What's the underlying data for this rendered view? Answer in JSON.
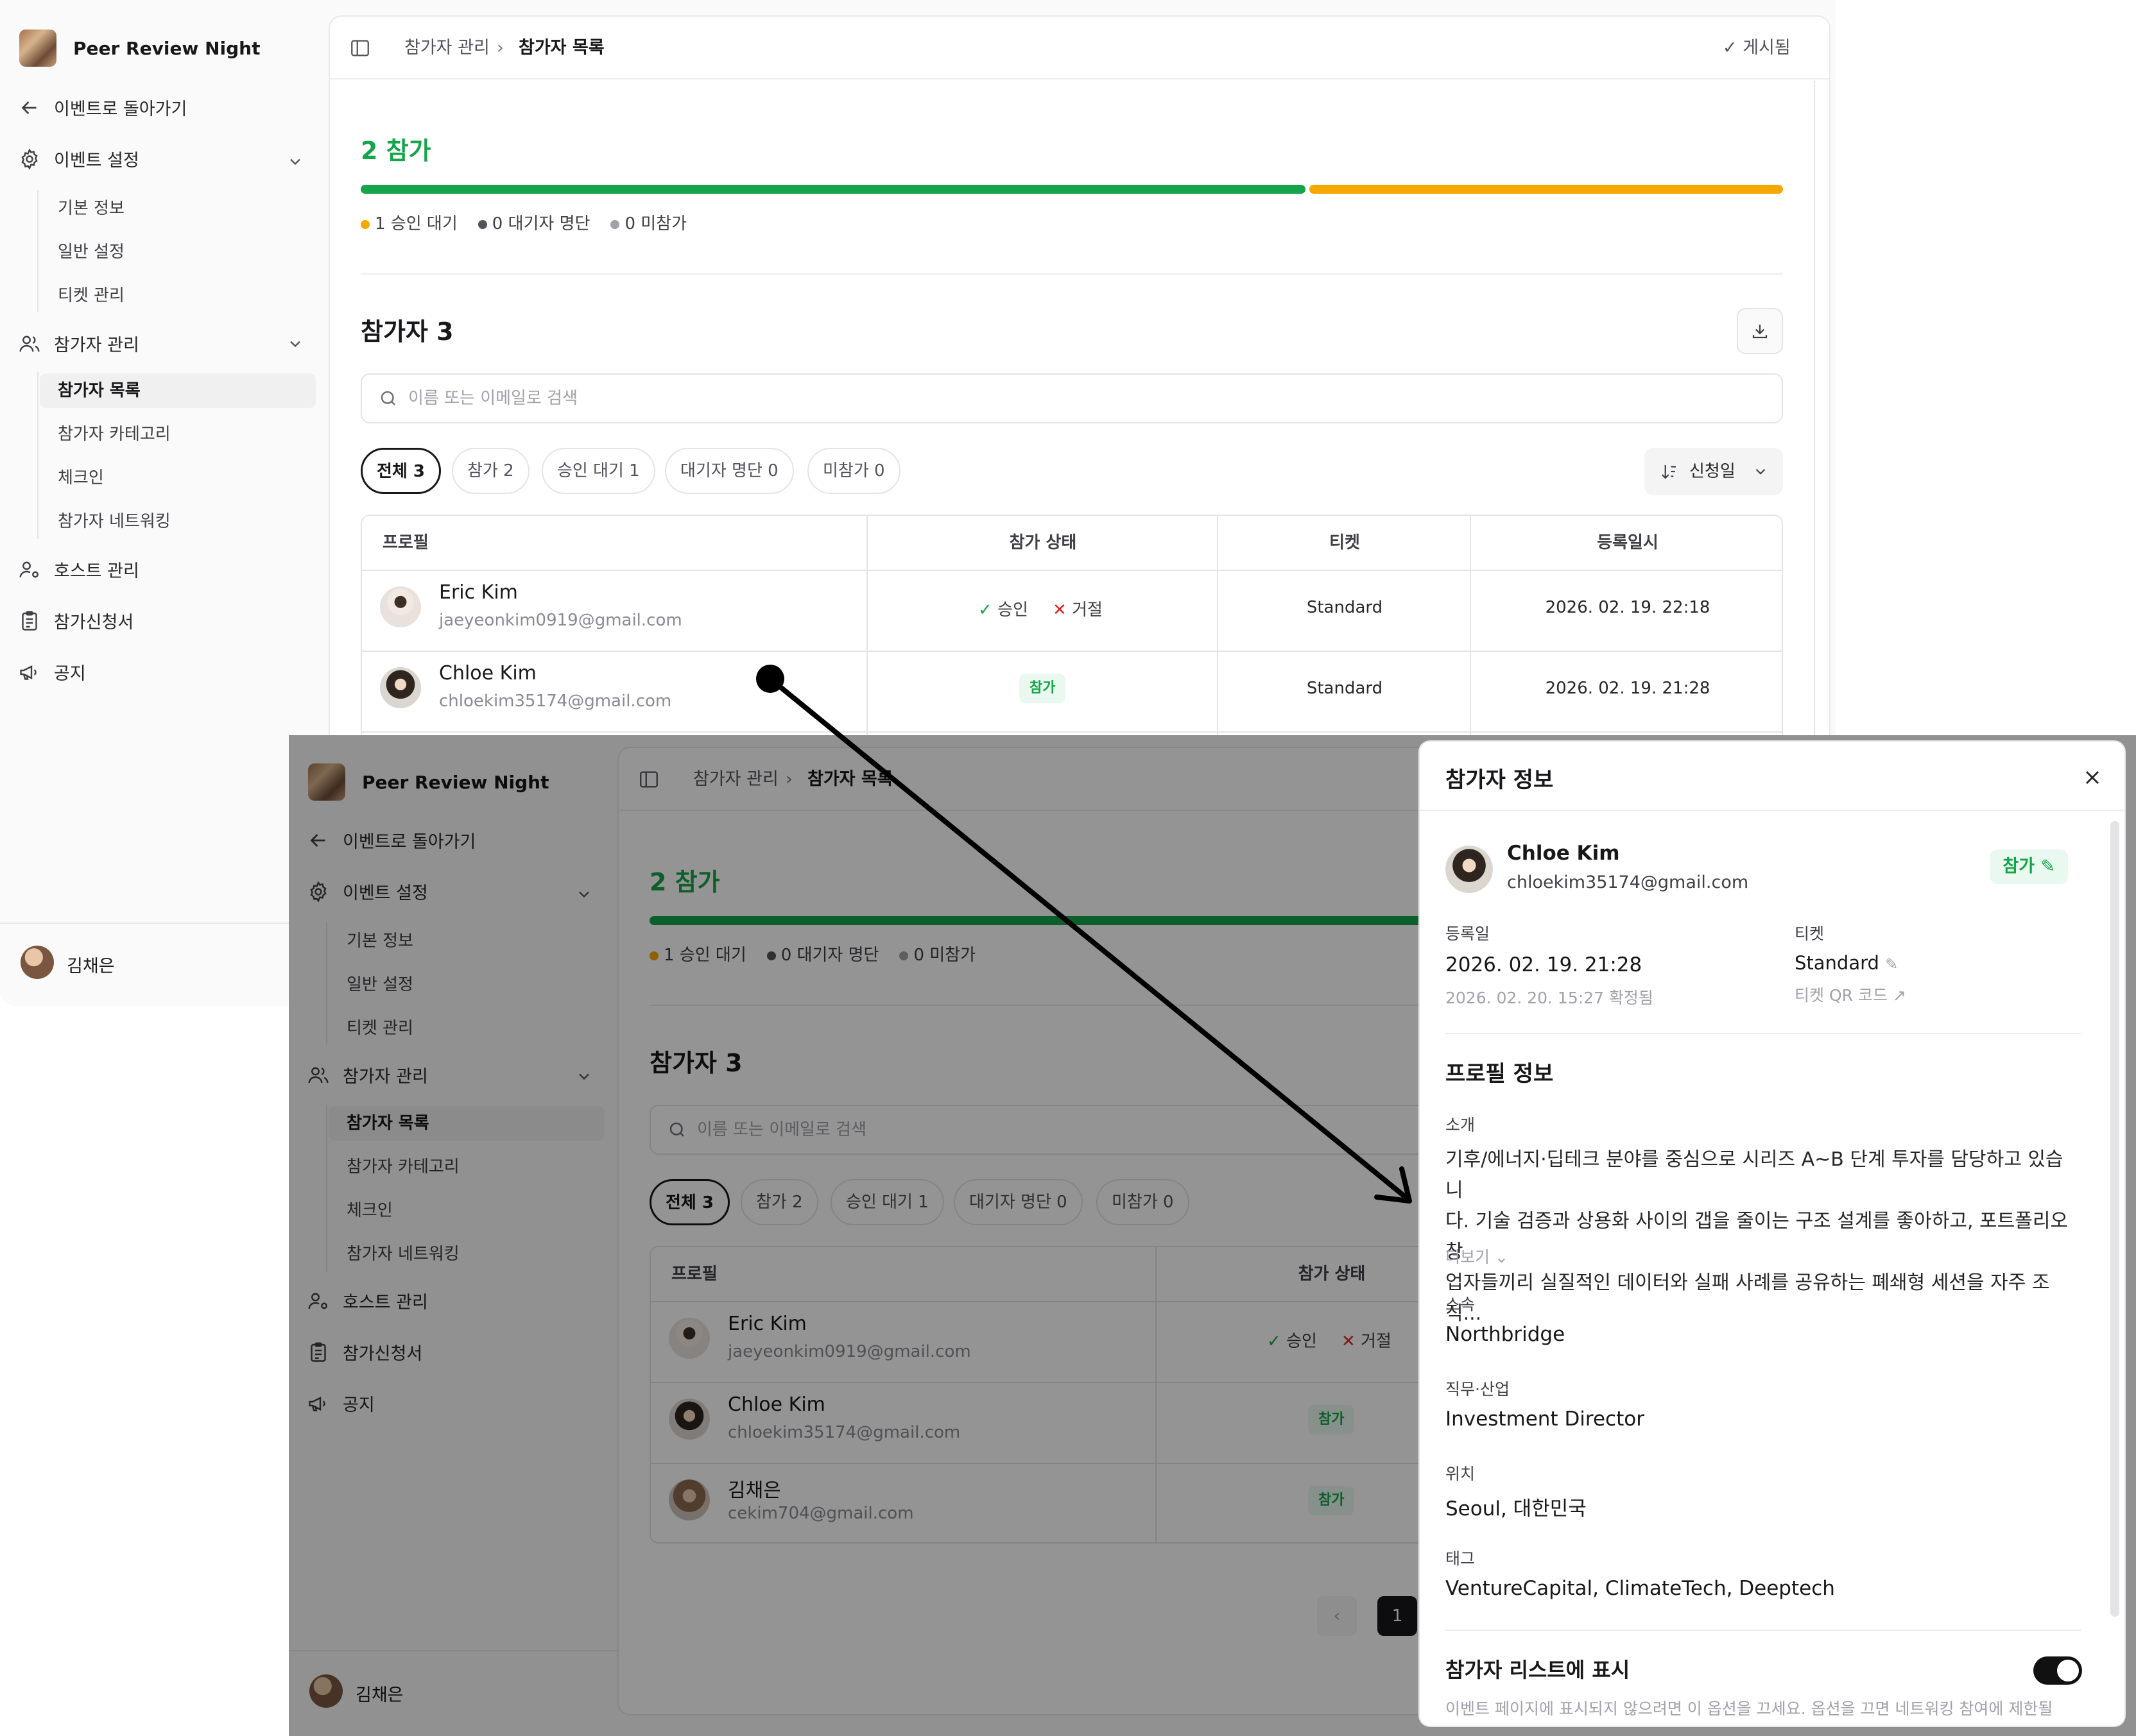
{
  "app": {
    "event_name": "Peer Review Night",
    "back_label": "이벤트로 돌아가기",
    "published_label": "게시됨",
    "user_name": "김채은"
  },
  "sidebar": {
    "event_settings": "이벤트 설정",
    "event_settings_items": [
      "기본 정보",
      "일반 설정",
      "티켓 관리"
    ],
    "participant_mgmt": "참가자 관리",
    "participant_items": [
      "참가자 목록",
      "참가자 카테고리",
      "체크인",
      "참가자 네트워킹"
    ],
    "host_mgmt": "호스트 관리",
    "application": "참가신청서",
    "notice": "공지"
  },
  "breadcrumb": {
    "parent": "참가자 관리",
    "current": "참가자 목록"
  },
  "summary": {
    "count_title": "2 참가",
    "legend": [
      {
        "text": "1 승인 대기",
        "color": "#f5a800"
      },
      {
        "text": "0 대기자 명단",
        "color": "#52525b"
      },
      {
        "text": "0 미참가",
        "color": "#a1a1aa"
      }
    ],
    "bar_colors": {
      "approved": "#16a34a",
      "pending": "#f5a800"
    }
  },
  "participants": {
    "title": "참가자 3",
    "search_placeholder": "이름 또는 이메일로 검색",
    "filters": [
      "전체 3",
      "참가 2",
      "승인 대기 1",
      "대기자 명단 0",
      "미참가 0"
    ],
    "sort_label": "신청일",
    "columns": [
      "프로필",
      "참가 상태",
      "티켓",
      "등록일시"
    ],
    "rows": [
      {
        "name": "Eric Kim",
        "email": "jaeyeonkim0919@gmail.com",
        "approve": "승인",
        "reject": "거절",
        "ticket": "Standard",
        "date": "2026. 02. 19. 22:18"
      },
      {
        "name": "Chloe Kim",
        "email": "chloekim35174@gmail.com",
        "status": "참가",
        "ticket": "Standard",
        "date": "2026. 02. 19. 21:28"
      },
      {
        "name": "김채은",
        "email": "cekim704@gmail.com",
        "status": "참가"
      }
    ],
    "page": "1"
  },
  "drawer": {
    "title": "참가자 정보",
    "name": "Chloe Kim",
    "email": "chloekim35174@gmail.com",
    "status": "참가",
    "registered_label": "등록일",
    "registered_value": "2026. 02. 19. 21:28",
    "confirmed_text": "2026. 02. 20. 15:27 확정됨",
    "ticket_label": "티켓",
    "ticket_value": "Standard",
    "ticket_qr": "티켓 QR 코드",
    "profile_title": "프로필 정보",
    "intro_label": "소개",
    "intro_lines": [
      "기후/에너지·딥테크 분야를 중심으로 시리즈 A~B 단계 투자를 담당하고 있습니",
      "다. 기술 검증과 상용화 사이의 갭을 줄이는 구조 설계를 좋아하고, 포트폴리오 창",
      "업자들끼리 실질적인 데이터와 실패 사례를 공유하는 폐쇄형 세션을 자주 조직..."
    ],
    "more": "더보기",
    "org_label": "소속",
    "org_value": "Northbridge",
    "job_label": "직무·산업",
    "job_value": "Investment Director",
    "loc_label": "위치",
    "loc_value": "Seoul, 대한민국",
    "tag_label": "태그",
    "tag_value": "VentureCapital, ClimateTech, Deeptech",
    "list_title": "참가자 리스트에 표시",
    "list_desc": "이벤트 페이지에 표시되지 않으려면 이 옵션을 끄세요. 옵션을 끄면 네트워킹 참여에 제한될",
    "list_visible": true
  }
}
